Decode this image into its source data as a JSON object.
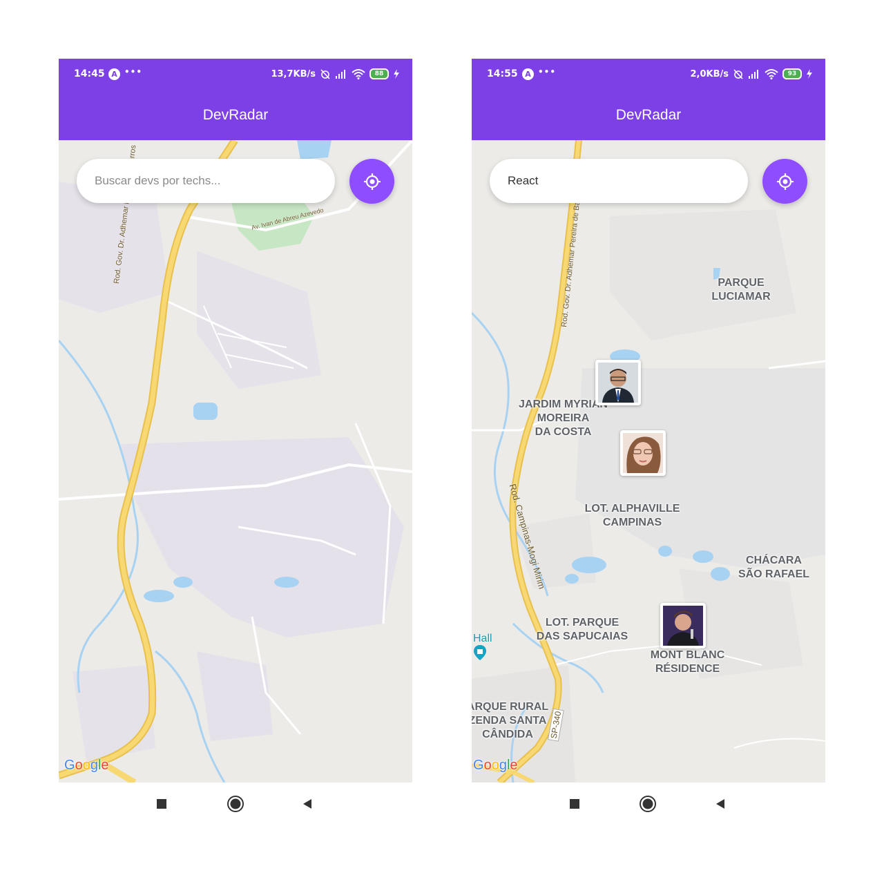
{
  "screens": [
    {
      "status": {
        "time": "14:45",
        "speed": "13,7KB/s",
        "battery": "88"
      },
      "app_title": "DevRadar",
      "search": {
        "value": "",
        "placeholder": "Buscar devs por techs..."
      },
      "road_labels": [
        "Rod. Gov. Dr. Adhemar Pereira de Barros",
        "Av. Ivan de Abreu Azevedo"
      ],
      "google_logo": "Google"
    },
    {
      "status": {
        "time": "14:55",
        "speed": "2,0KB/s",
        "battery": "93"
      },
      "app_title": "DevRadar",
      "search": {
        "value": "React",
        "placeholder": "Buscar devs por techs..."
      },
      "places": [
        "PARQUE\nLUCIAMAR",
        "JARDIM MYRIAN\nMOREIRA\nDA COSTA",
        "LOT. ALPHAVILLE\nCAMPINAS",
        "CHÁCARA\nSÃO RAFAEL",
        "LOT. PARQUE\nDAS SAPUCAIAS",
        "MONT BLANC\nRÉSIDENCE",
        "ARQUE RURAL\nZENDA SANTA\nCÂNDIDA"
      ],
      "road_labels": [
        "Rod. Gov. Dr. Adhemar Pereira de Barros",
        "Rod. Campinas-Mogi Mirim",
        "SP-340"
      ],
      "poi": "Hall",
      "google_logo": "Google",
      "dev_markers": 3
    }
  ],
  "icons": {
    "locate": "crosshair-icon",
    "nav": [
      "square-icon",
      "circle-icon",
      "triangle-back-icon"
    ]
  },
  "colors": {
    "primary": "#7d40e7",
    "button": "#8e4dff",
    "road": "#f6d36b",
    "map": "#ecebe8",
    "water": "#a8d2f2"
  }
}
